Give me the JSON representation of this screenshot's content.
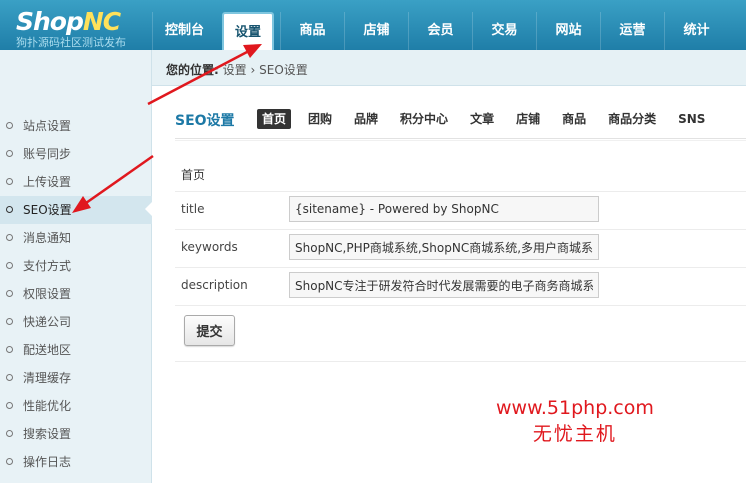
{
  "logo": {
    "main_prefix": "Shop",
    "main_suffix": "NC",
    "subtitle": "狗扑源码社区测试发布"
  },
  "nav": [
    {
      "label": "控制台"
    },
    {
      "label": "设置",
      "active": true
    },
    {
      "label": "商品"
    },
    {
      "label": "店铺"
    },
    {
      "label": "会员"
    },
    {
      "label": "交易"
    },
    {
      "label": "网站"
    },
    {
      "label": "运营"
    },
    {
      "label": "统计"
    }
  ],
  "breadcrumb": {
    "prefix": "您的位置:",
    "parent": "设置",
    "separator": "›",
    "current": "SEO设置"
  },
  "sidebar": [
    "站点设置",
    "账号同步",
    "上传设置",
    "SEO设置",
    "消息通知",
    "支付方式",
    "权限设置",
    "快递公司",
    "配送地区",
    "清理缓存",
    "性能优化",
    "搜索设置",
    "操作日志"
  ],
  "sidebar_active_index": 3,
  "page": {
    "title": "SEO设置",
    "tabs": [
      "首页",
      "团购",
      "品牌",
      "积分中心",
      "文章",
      "店铺",
      "商品",
      "商品分类",
      "SNS"
    ],
    "active_tab_index": 0,
    "section_label": "首页",
    "fields": [
      {
        "label": "title",
        "value": "{sitename} - Powered by ShopNC"
      },
      {
        "label": "keywords",
        "value": "ShopNC,PHP商城系统,ShopNC商城系统,多用户商城系统"
      },
      {
        "label": "description",
        "value": "ShopNC专注于研发符合时代发展需要的电子商务商城系统"
      }
    ],
    "submit_label": "提交"
  },
  "watermark": {
    "url": "www.51php.com",
    "text": "无忧主机"
  },
  "colors": {
    "header": "#2a8fb8",
    "accent": "#1d79a6",
    "arrow": "#e0181e",
    "logo_nc": "#ffe15a"
  }
}
